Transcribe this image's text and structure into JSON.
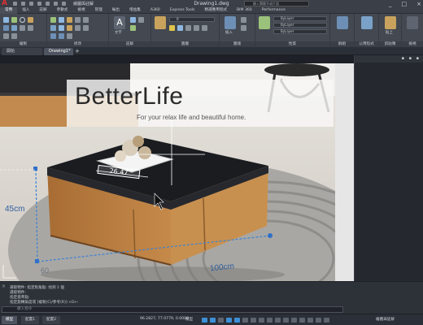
{
  "titlebar": {
    "logo": "A",
    "workspace": "繪圖與註解",
    "document_title": "Drawing1.dwg",
    "search_placeholder": "鍵入關鍵字或片語",
    "window_controls": [
      "_",
      "□",
      "×"
    ]
  },
  "menubar": {
    "tabs": [
      "常用",
      "插入",
      "註解",
      "參數式",
      "檢視",
      "管理",
      "輸出",
      "增益集",
      "A360",
      "Express Tools",
      "精選應用程式",
      "BIM 360",
      "Performance"
    ],
    "active_index": 0
  },
  "ribbon": {
    "panels": [
      "繪製",
      "修改",
      "註解",
      "圖層",
      "圖塊",
      "性質",
      "群組",
      "公用程式",
      "剪貼簿",
      "檢視"
    ],
    "big_buttons": [
      "文字",
      "插入",
      "貼上"
    ],
    "property_dropdowns": [
      "ByLayer",
      "ByLayer",
      "ByLayer"
    ],
    "layer_dropdown": "0"
  },
  "doc_tabs": {
    "tabs": [
      "開始",
      "Drawing1*"
    ],
    "active_index": 1,
    "new_tab": "+"
  },
  "canvas": {
    "brand_title": "BetterLife",
    "brand_tagline": "For your relax life and beautiful home.",
    "dimension_tray": "26.47",
    "dimension_height": "45cm",
    "dimension_width": "100cm",
    "dimension_depth": "60"
  },
  "command": {
    "history": [
      "選取物件: 指定對角點: 找到 1 個",
      "選取物件:",
      "指定基準點:",
      "指定旋轉角度或 [複製(C)/參考(R)] <0>:"
    ],
    "input_placeholder": "鍵入指令"
  },
  "statusbar": {
    "layout_tabs": [
      "模型",
      "配置1",
      "配置2"
    ],
    "active_index": 0,
    "coords": "96.2827, 77.0779, 0.0000",
    "mode": "模型",
    "workspace": "繪圖與註解"
  },
  "colors": {
    "accent": "#3d8fd6",
    "logo_red": "#e03030",
    "table_top": "#1a1c20",
    "wood": "#b87e3f"
  }
}
